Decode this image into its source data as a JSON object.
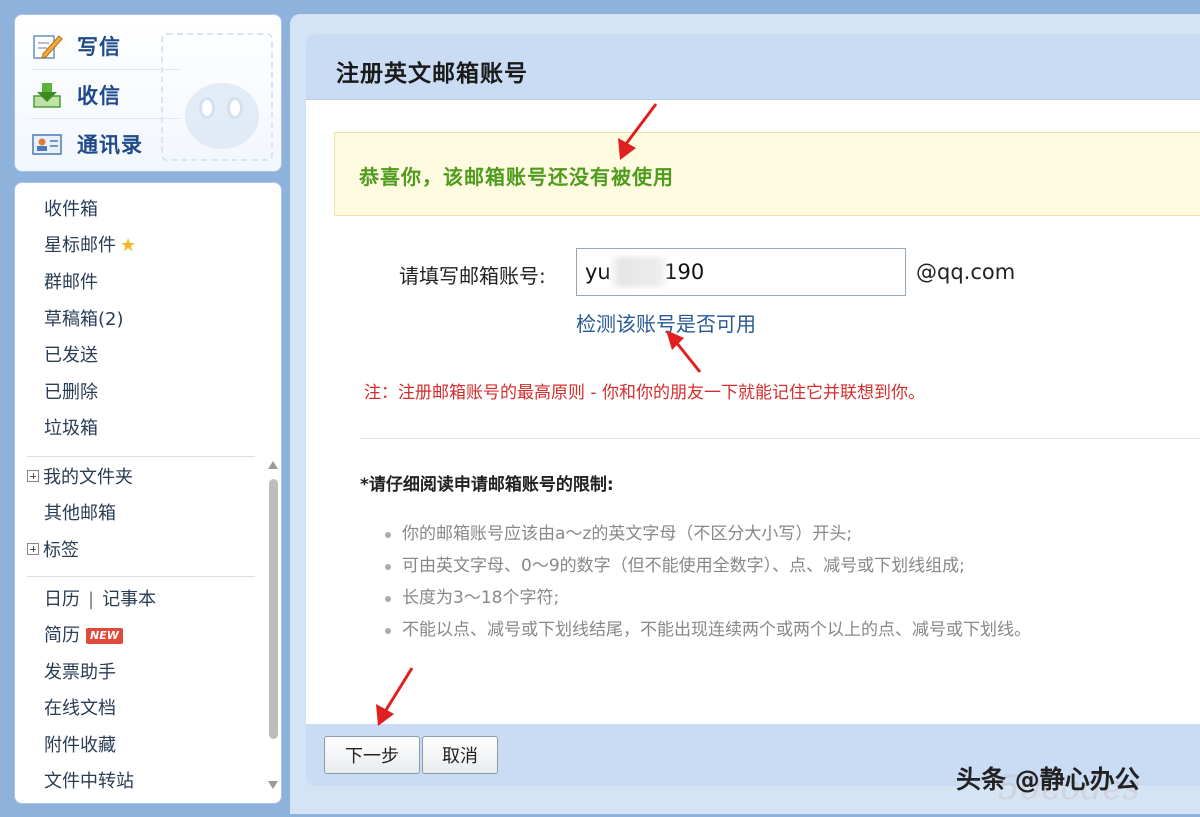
{
  "quick_actions": [
    {
      "label": "写信",
      "icon": "pencil-paper-icon"
    },
    {
      "label": "收信",
      "icon": "inbox-download-icon"
    },
    {
      "label": "通讯录",
      "icon": "contact-card-icon"
    }
  ],
  "folders": {
    "inbox": "收件箱",
    "starred": "星标邮件",
    "group": "群邮件",
    "drafts": "草稿箱(2)",
    "sent": "已发送",
    "deleted": "已删除",
    "spam": "垃圾箱",
    "my_folders": "我的文件夹",
    "other_mailbox": "其他邮箱",
    "tags": "标签",
    "calendar": "日历",
    "separator": "|",
    "notepad": "记事本",
    "resume": "简历",
    "new_badge": "NEW",
    "invoice": "发票助手",
    "docs": "在线文档",
    "attachments": "附件收藏",
    "transfer": "文件中转站"
  },
  "main": {
    "title": "注册英文邮箱账号",
    "success_message": "恭喜你，该邮箱账号还没有被使用",
    "field_label": "请填写邮箱账号:",
    "email_value": "yu        190",
    "domain_suffix": "@qq.com",
    "check_link": "检测该账号是否可用",
    "note": "注：注册邮箱账号的最高原则 - 你和你的朋友一下就能记住它并联想到你。",
    "rules_title": "*请仔细阅读申请邮箱账号的限制:",
    "rules": [
      "你的邮箱账号应该由a～z的英文字母（不区分大小写）开头;",
      "可由英文字母、0～9的数字（但不能使用全数字）、点、减号或下划线组成;",
      "长度为3～18个字符;",
      "不能以点、减号或下划线结尾，不能出现连续两个或两个以上的点、减号或下划线。"
    ],
    "next_button": "下一步",
    "cancel_button": "取消"
  },
  "watermark": "头条 @静心办公",
  "colors": {
    "accent_blue": "#1f4a8a",
    "success_green": "#4e9b1e",
    "note_red": "#d42d2d",
    "link_blue": "#2a5a93",
    "annotation_arrow": "#e02020"
  }
}
